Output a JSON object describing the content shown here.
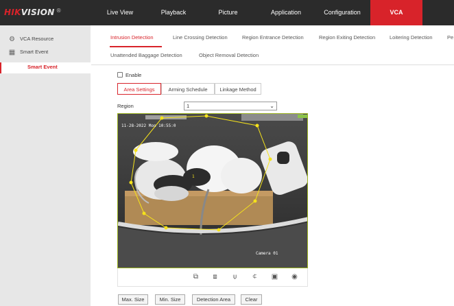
{
  "brand": {
    "logo_hik": "HIK",
    "logo_vision": "VISION",
    "logo_reg": "®"
  },
  "nav": [
    "Live View",
    "Playback",
    "Picture",
    "Application",
    "Configuration",
    "VCA"
  ],
  "sidebar": {
    "items": [
      {
        "label": "VCA Resource",
        "icon": "vca-resource-icon"
      },
      {
        "label": "Smart Event",
        "icon": "smart-event-icon"
      }
    ],
    "sub_item": "Smart Event"
  },
  "tabs": {
    "row1": [
      "Intrusion Detection",
      "Line Crossing Detection",
      "Region Entrance Detection",
      "Region Exiting Detection",
      "Loitering Detection",
      "Pe"
    ],
    "row2": [
      "Unattended Baggage Detection",
      "Object Removal Detection"
    ],
    "active": "Intrusion Detection"
  },
  "enable": {
    "label": "Enable",
    "checked": false
  },
  "subtabs": [
    "Area Settings",
    "Arming Schedule",
    "Linkage Method"
  ],
  "region": {
    "label": "Region",
    "value": "1"
  },
  "video": {
    "timestamp": "11-28-2022 Mon 10:55:0",
    "camera_label": "Camera 01",
    "region_number": "1"
  },
  "controls": [
    "window-restore-icon",
    "window-fit-icon",
    "zoom-out-icon",
    "zoom-in-icon",
    "record-icon",
    "snapshot-icon"
  ],
  "buttons": {
    "max_size": "Max. Size",
    "min_size": "Min. Size",
    "detection_area": "Detection Area",
    "clear": "Clear"
  },
  "colors": {
    "accent": "#d8232a",
    "topbar": "#2b2b2b",
    "region_line": "#f5e21b"
  }
}
